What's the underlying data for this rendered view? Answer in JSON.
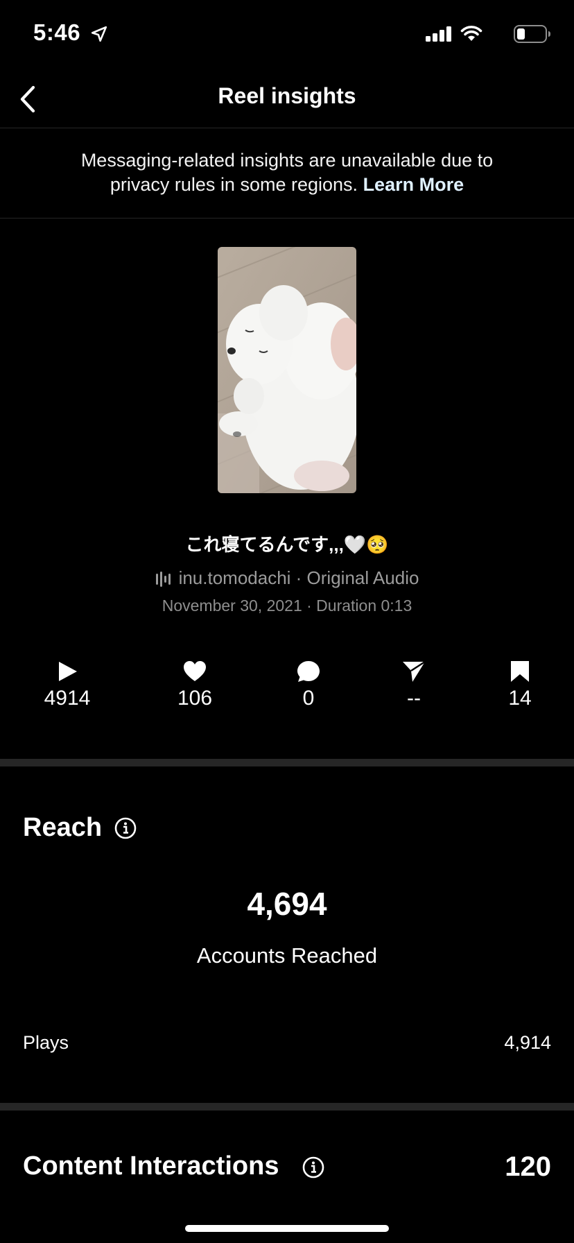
{
  "status_bar": {
    "time": "5:46"
  },
  "nav": {
    "title": "Reel insights"
  },
  "notice": {
    "text_line1": "Messaging-related insights are unavailable due to",
    "text_line2": "privacy rules in some regions.",
    "link": "Learn More"
  },
  "reel": {
    "caption": "これ寝てるんです,,,🤍🥺",
    "audio": "inu.tomodachi · Original Audio",
    "meta": "November 30, 2021 · Duration 0:13"
  },
  "stats": {
    "plays": "4914",
    "likes": "106",
    "comments": "0",
    "shares": "--",
    "saves": "14"
  },
  "reach": {
    "title": "Reach",
    "accounts_reached_value": "4,694",
    "accounts_reached_label": "Accounts Reached",
    "plays_label": "Plays",
    "plays_value": "4,914"
  },
  "content_interactions": {
    "title": "Content Interactions",
    "value": "120"
  },
  "colors": {
    "background": "#000000",
    "separator": "#262626",
    "secondary_text": "#8e8e8e"
  }
}
